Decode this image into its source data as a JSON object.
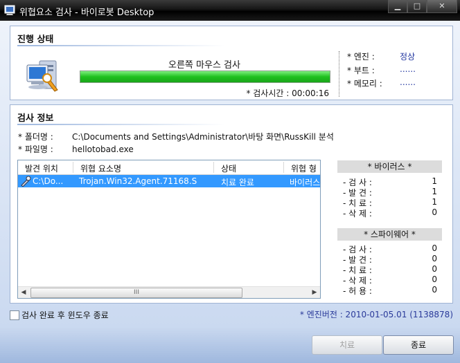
{
  "window": {
    "title": "위협요소 검사 - 바이로봇 Desktop"
  },
  "progress_section": {
    "title": "진행 상태",
    "scan_target": "오른쪽 마우스 검사",
    "progress_fraction": 1.0,
    "scan_time": "* 검사시간 : 00:00:16",
    "engine_label": "* 엔진 :",
    "engine_value": "정상",
    "boot_label": "* 부트 :",
    "boot_value": "......",
    "memory_label": "* 메모리 :",
    "memory_value": "......"
  },
  "info_section": {
    "title": "검사 정보",
    "folder_label": "* 폴더명 :",
    "folder_value": "C:\\Documents and Settings\\Administrator\\바탕 화면\\RussKill 분석",
    "file_label": "* 파일명 :",
    "file_value": "hellotobad.exe",
    "columns": [
      "발견 위치",
      "위협 요소명",
      "상태",
      "위협 형"
    ],
    "rows": [
      {
        "location": "C:\\Do...",
        "threat": "Trojan.Win32.Agent.71168.S",
        "status": "치료 완료",
        "type": "바이러스"
      }
    ],
    "scroll_grip": "III"
  },
  "stats": {
    "virus": {
      "header": "* 바이러스 *",
      "items": [
        {
          "label": "- 검 사 :",
          "value": "1"
        },
        {
          "label": "- 발 견 :",
          "value": "1"
        },
        {
          "label": "- 치 료 :",
          "value": "1"
        },
        {
          "label": "- 삭 제 :",
          "value": "0"
        }
      ]
    },
    "spyware": {
      "header": "* 스파이웨어 *",
      "items": [
        {
          "label": "- 검 사 :",
          "value": "0"
        },
        {
          "label": "- 발 견 :",
          "value": "0"
        },
        {
          "label": "- 치 료 :",
          "value": "0"
        },
        {
          "label": "- 삭 제 :",
          "value": "0"
        },
        {
          "label": "- 허 용 :",
          "value": "0"
        }
      ]
    }
  },
  "footer": {
    "close_window_checkbox": "검사 완료 후 윈도우 종료",
    "engine_version": "* 엔진버전 : 2010-01-05.01 (1138878)",
    "treat_button": "치료",
    "exit_button": "종료"
  },
  "colors": {
    "progress": "#1fc11f",
    "selection": "#3399ff",
    "title_bar": "#000000",
    "link_blue": "#2236a0"
  }
}
